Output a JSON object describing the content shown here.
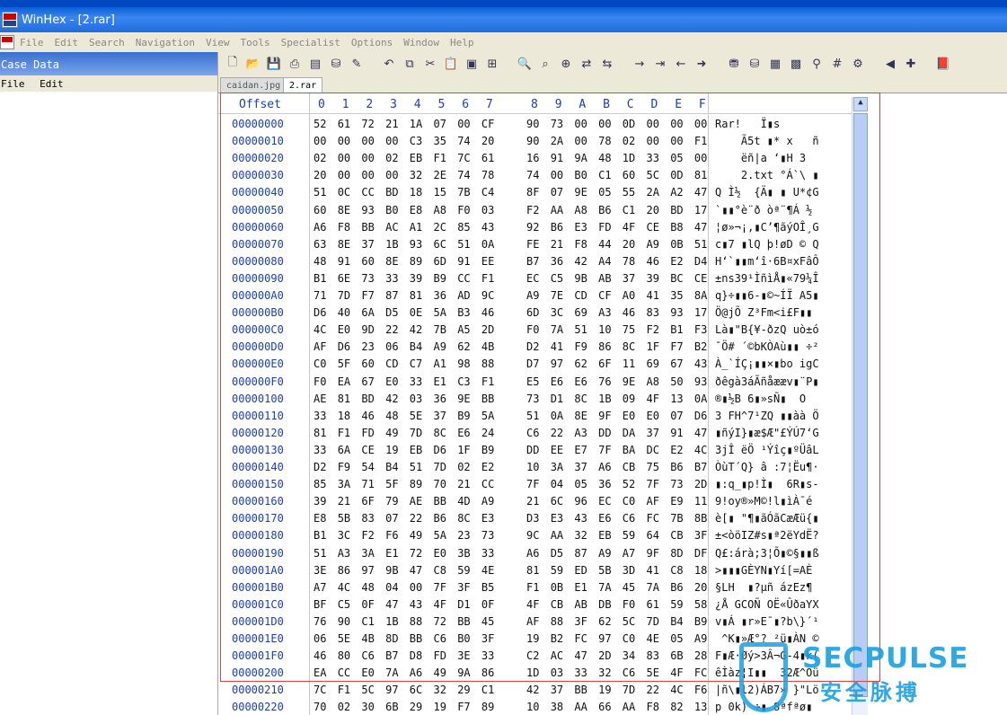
{
  "window": {
    "title": "WinHex - [2.rar]"
  },
  "menu": [
    "File",
    "Edit",
    "Search",
    "Navigation",
    "View",
    "Tools",
    "Specialist",
    "Options",
    "Window",
    "Help"
  ],
  "case": {
    "title": "Case Data",
    "menu": [
      "File",
      "Edit"
    ]
  },
  "tabs": [
    {
      "label": "caidan.jpg",
      "active": false
    },
    {
      "label": "2.rar",
      "active": true
    }
  ],
  "hex": {
    "offset_label": "Offset",
    "col_headers": [
      "0",
      "1",
      "2",
      "3",
      "4",
      "5",
      "6",
      "7",
      "8",
      "9",
      "A",
      "B",
      "C",
      "D",
      "E",
      "F"
    ],
    "rows": [
      {
        "off": "00000000",
        "bytes": "52 61 72 21 1A 07 00 CF 90 73 00 00 0D 00 00 00",
        "asc": "Rar!   Ï▮s"
      },
      {
        "off": "00000010",
        "bytes": "00 00 00 00 C3 35 74 20 90 2A 00 78 02 00 00 F1",
        "asc": "    Ã5t ▮* x   ñ"
      },
      {
        "off": "00000020",
        "bytes": "02 00 00 02 EB F1 7C 61 16 91 9A 48 1D 33 05 00",
        "asc": "    ëñ|a ‘▮H 3"
      },
      {
        "off": "00000030",
        "bytes": "20 00 00 00 32 2E 74 78 74 00 B0 C1 60 5C 0D 81",
        "asc": "    2.txt °Á`\\ ▮"
      },
      {
        "off": "00000040",
        "bytes": "51 0C CC BD 18 15 7B C4 8F 07 9E 05 55 2A A2 47",
        "asc": "Q Ì½  {Ä▮ ▮ U*¢G"
      },
      {
        "off": "00000050",
        "bytes": "60 8E 93 B0 E8 A8 F0 03 F2 AA A8 B6 C1 20 BD 17",
        "asc": "`▮▮°è¨ð òª¨¶Á ½"
      },
      {
        "off": "00000060",
        "bytes": "A6 F8 BB AC A1 2C 85 43 92 B6 E3 FD 4F CE B8 47",
        "asc": "¦ø»¬¡,▮C’¶ãýOÎ¸G"
      },
      {
        "off": "00000070",
        "bytes": "63 8E 37 1B 93 6C 51 0A FE 21 F8 44 20 A9 0B 51",
        "asc": "c▮7 ▮lQ þ!øD © Q"
      },
      {
        "off": "00000080",
        "bytes": "48 91 60 8E 89 6D 91 EE B7 36 42 A4 78 46 E2 D4",
        "asc": "H‘`▮▮m‘î·6B¤xFâÔ"
      },
      {
        "off": "00000090",
        "bytes": "B1 6E 73 33 39 B9 CC F1 EC C5 9B AB 37 39 BC CE",
        "asc": "±ns39¹ÌñìÅ▮«79¼Î"
      },
      {
        "off": "000000A0",
        "bytes": "71 7D F7 87 81 36 AD 9C A9 7E CD CF A0 41 35 8A",
        "asc": "q}÷▮▮6-▮©~ÍÏ A5▮"
      },
      {
        "off": "000000B0",
        "bytes": "D6 40 6A D5 0E 5A B3 46 6D 3C 69 A3 46 83 93 17",
        "asc": "Ö@jÕ Z³Fm<i£F▮▮"
      },
      {
        "off": "000000C0",
        "bytes": "4C E0 9D 22 42 7B A5 2D F0 7A 51 10 75 F2 B1 F3",
        "asc": "Là▮\"B{¥-ðzQ uò±ó"
      },
      {
        "off": "000000D0",
        "bytes": "AF D6 23 06 B4 A9 62 4B D2 41 F9 86 8C 1F F7 B2",
        "asc": "¯Ö# ´©bKÒAù▮▮ ÷²"
      },
      {
        "off": "000000E0",
        "bytes": "C0 5F 60 CD C7 A1 98 88 D7 97 62 6F 11 69 67 43",
        "asc": "À_`ÍÇ¡▮▮×▮bo igC"
      },
      {
        "off": "000000F0",
        "bytes": "F0 EA 67 E0 33 E1 C3 F1 E5 E6 E6 76 9E A8 50 93",
        "asc": "ðêgà3áÃñåææv▮¨P▮"
      },
      {
        "off": "00000100",
        "bytes": "AE 81 BD 42 03 36 9E BB 73 D1 8C 1B 09 4F 13 0A",
        "asc": "®▮½B 6▮»sÑ▮  O"
      },
      {
        "off": "00000110",
        "bytes": "33 18 46 48 5E 37 B9 5A 51 0A 8E 9F E0 E0 07 D6",
        "asc": "3 FH^7¹ZQ ▮▮àà Ö"
      },
      {
        "off": "00000120",
        "bytes": "81 F1 FD 49 7D 8C E6 24 C6 22 A3 DD DA 37 91 47",
        "asc": "▮ñýI}▮æ$Æ\"£ÝÚ7‘G"
      },
      {
        "off": "00000130",
        "bytes": "33 6A CE 19 EB D6 1F B9 DD EE E7 7F BA DC E2 4C",
        "asc": "3jÎ ëÖ ¹Ýîç▮ºÜâL"
      },
      {
        "off": "00000140",
        "bytes": "D2 F9 54 B4 51 7D 02 E2 10 3A 37 A6 CB 75 B6 B7",
        "asc": "ÒùT´Q} â :7¦Ëu¶·"
      },
      {
        "off": "00000150",
        "bytes": "85 3A 71 5F 89 70 21 CC 7F 04 05 36 52 7F 73 2D",
        "asc": "▮:q_▮p!Ì▮  6R▮s-"
      },
      {
        "off": "00000160",
        "bytes": "39 21 6F 79 AE BB 4D A9 21 6C 96 EC C0 AF E9 11",
        "asc": "9!oy®»M©!l▮ìÀ¯é"
      },
      {
        "off": "00000170",
        "bytes": "E8 5B 83 07 22 B6 8C E3 D3 E3 43 E6 C6 FC 7B 8B",
        "asc": "è[▮ \"¶▮ãÓãCæÆü{▮"
      },
      {
        "off": "00000180",
        "bytes": "B1 3C F2 F6 49 5A 23 73 9C AA 32 EB 59 64 CB 3F",
        "asc": "±<òöIZ#s▮ª2ëYdË?"
      },
      {
        "off": "00000190",
        "bytes": "51 A3 3A E1 72 E0 3B 33 A6 D5 87 A9 A7 9F 8D DF",
        "asc": "Q£:árà;3¦Õ▮©§▮▮ß"
      },
      {
        "off": "000001A0",
        "bytes": "3E 86 97 9B 47 C8 59 4E 81 59 ED 5B 3D 41 C8 18",
        "asc": ">▮▮▮GÈYN▮Yí[=AÈ"
      },
      {
        "off": "000001B0",
        "bytes": "A7 4C 48 04 00 7F 3F B5 F1 0B E1 7A 45 7A B6 20",
        "asc": "§LH  ▮?µñ ázEz¶"
      },
      {
        "off": "000001C0",
        "bytes": "BF C5 0F 47 43 4F D1 0F 4F CB AB DB F0 61 59 58",
        "asc": "¿Å GCOÑ OË«ÛðaYX"
      },
      {
        "off": "000001D0",
        "bytes": "76 90 C1 1B 88 72 BB 45 AF 88 3F 62 5C 7D B4 B9",
        "asc": "v▮Á ▮r»E¯▮?b\\}´¹"
      },
      {
        "off": "000001E0",
        "bytes": "06 5E 4B 8D BB C6 B0 3F 19 B2 FC 97 C0 4E 05 A9",
        "asc": " ^K▮»Æ°? ²ü▮ÀN ©"
      },
      {
        "off": "000001F0",
        "bytes": "46 80 C6 B7 D8 FD 3E 33 C2 AC 47 2D 34 83 6B 28",
        "asc": "F▮Æ·Øý>3Â¬G-4▮k("
      },
      {
        "off": "00000200",
        "bytes": "EA CC E0 7A A6 49 9A 86 1D 03 33 32 C6 5E 4F FC",
        "asc": "êÌàz¦I▮▮  32Æ^Oü"
      },
      {
        "off": "00000210",
        "bytes": "7C F1 5C 97 6C 32 29 C1 42 37 BB 19 7D 22 4C F6",
        "asc": "|ñ\\▮l2)ÁB7» }\"Lö"
      },
      {
        "off": "00000220",
        "bytes": "70 02 30 6B 29 19 F7 89 10 38 AA 66 AA F8 82 13",
        "asc": "p 0k) ÷▮ 8ªfªø▮"
      }
    ]
  },
  "watermark": {
    "text": "SECPULSE",
    "cn": "安全脉搏"
  }
}
